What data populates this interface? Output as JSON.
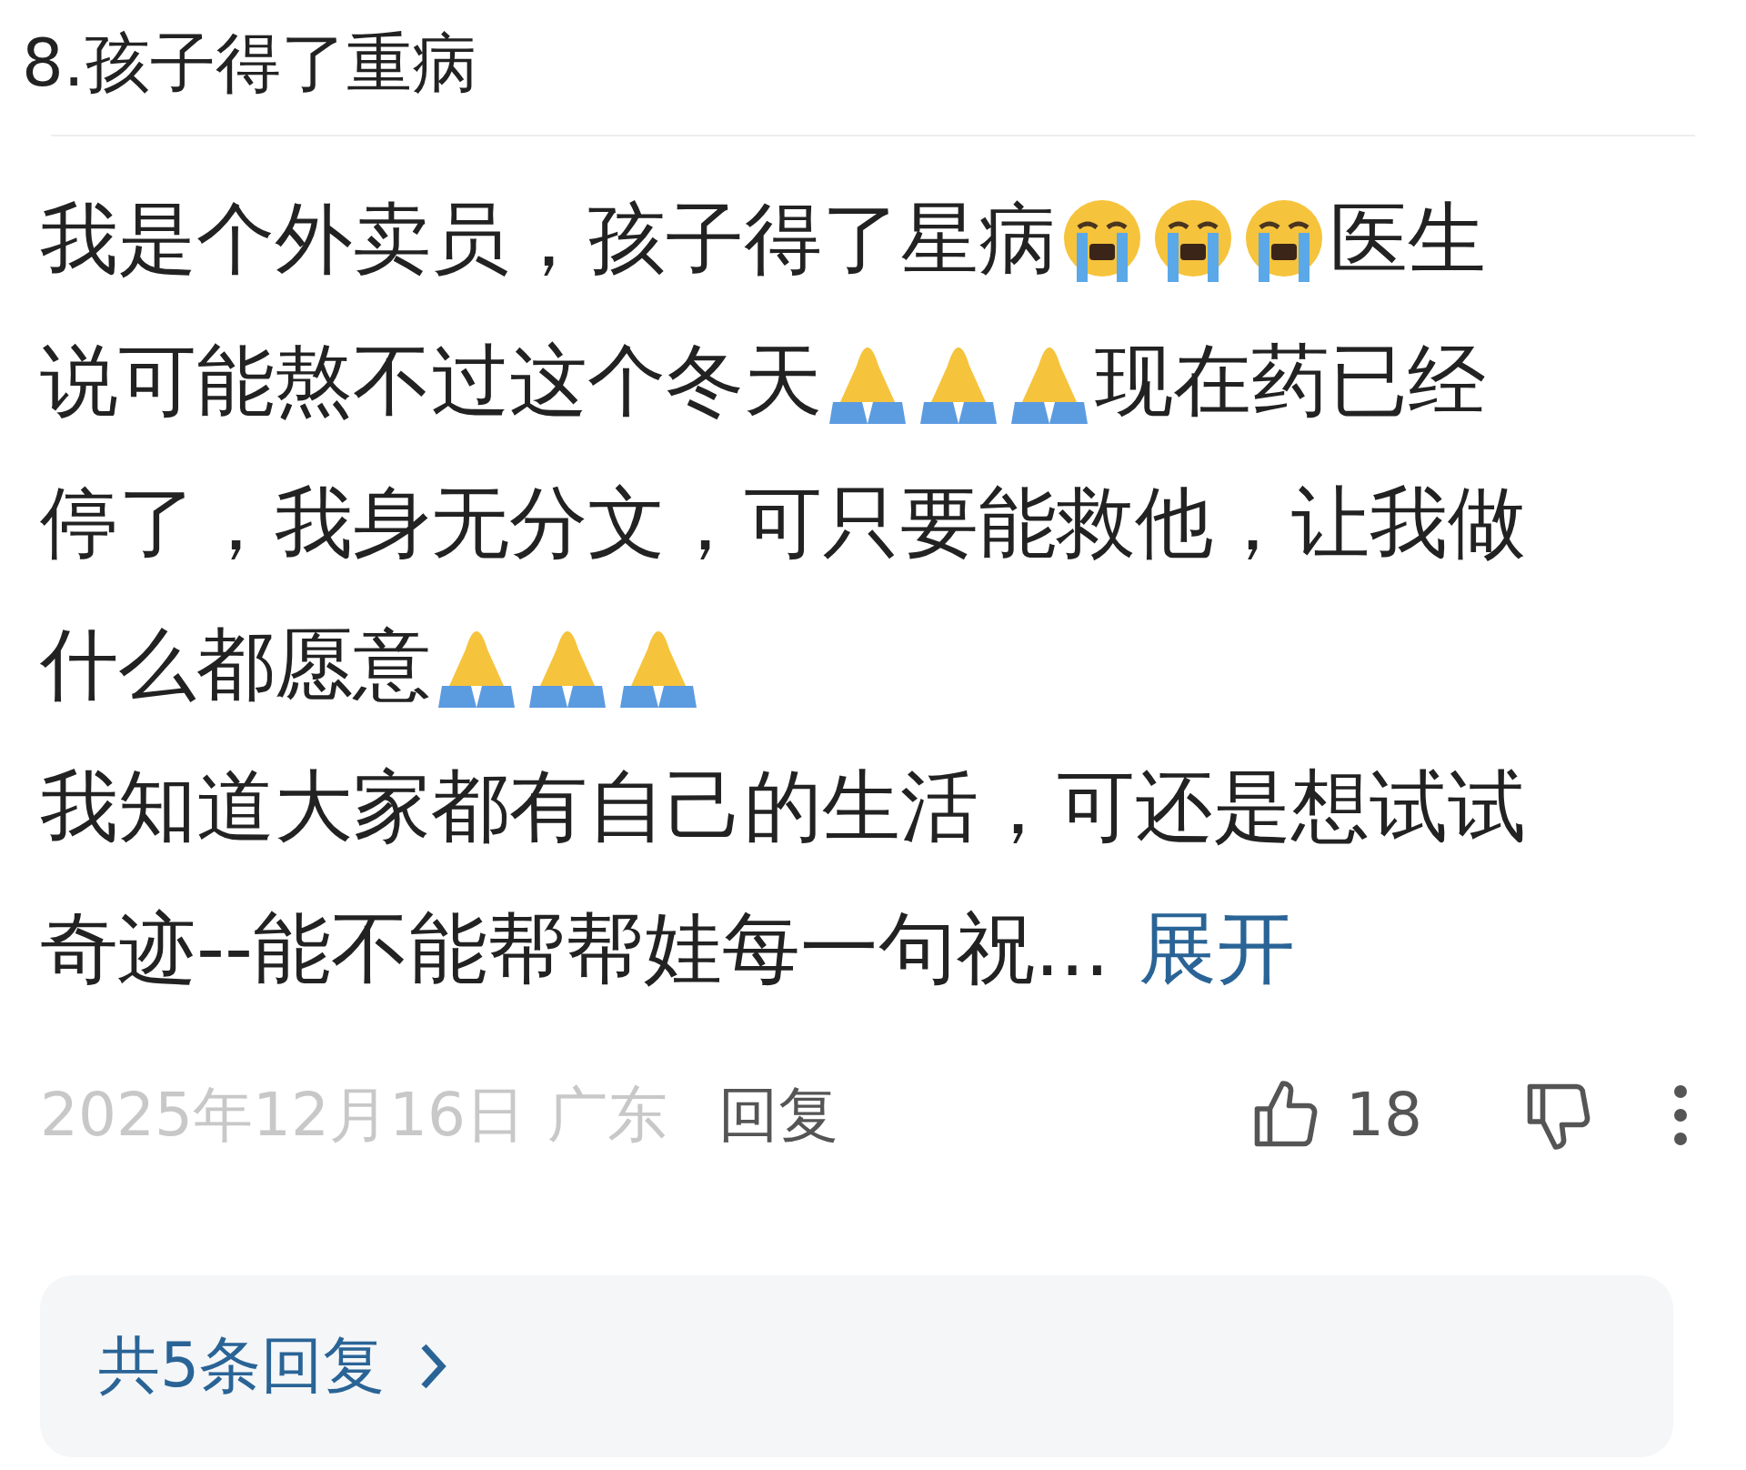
{
  "title": "8.孩子得了重病",
  "comment": {
    "lines": [
      [
        {
          "kind": "text",
          "text": "我是个外卖员，孩子得了星病"
        },
        {
          "kind": "crying"
        },
        {
          "kind": "crying"
        },
        {
          "kind": "crying"
        },
        {
          "kind": "text",
          "text": "医生"
        }
      ],
      [
        {
          "kind": "text",
          "text": "说可能熬不过这个冬天"
        },
        {
          "kind": "praying"
        },
        {
          "kind": "praying"
        },
        {
          "kind": "praying"
        },
        {
          "kind": "text",
          "text": "现在药已经"
        }
      ],
      [
        {
          "kind": "text",
          "text": "停了，我身无分文，可只要能救他，让我做"
        }
      ],
      [
        {
          "kind": "text",
          "text": "什么都愿意"
        },
        {
          "kind": "praying"
        },
        {
          "kind": "praying"
        },
        {
          "kind": "praying"
        }
      ],
      [
        {
          "kind": "text",
          "text": "我知道大家都有自己的生活，可还是想试试"
        }
      ],
      [
        {
          "kind": "text",
          "text": "奇迹--能不能帮帮娃每一句祝..."
        },
        {
          "kind": "link",
          "text": "展开"
        }
      ]
    ],
    "date": "2025年12月16日",
    "location": "广东",
    "reply_label": "回复",
    "likes": "18"
  },
  "replies": {
    "label": "共5条回复"
  }
}
